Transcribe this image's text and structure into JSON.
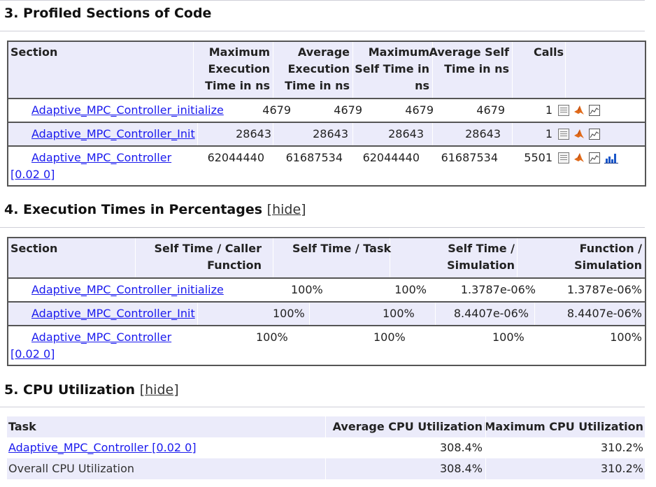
{
  "sections": {
    "profiled": {
      "title": "3. Profiled Sections of Code",
      "headers": {
        "section": "Section",
        "max_exec_l1": "Maximum",
        "max_exec_l2": "Execution",
        "max_exec_l3": "Time in ns",
        "avg_exec_l1": "Average",
        "avg_exec_l2": "Execution",
        "avg_exec_l3": "Time in ns",
        "max_self_l1": "Maximum",
        "max_self_l2": "Self Time in",
        "max_self_l3": "ns",
        "avg_self_l1": "Average Self",
        "avg_self_l2": "Time in ns",
        "calls": "Calls"
      },
      "rows": [
        {
          "name": "Adaptive_MPC_Controller_initialize",
          "max_exec": "4679",
          "avg_exec": "4679",
          "max_self": "4679",
          "avg_self": "4679",
          "calls": "1"
        },
        {
          "name": "Adaptive_MPC_Controller_Init",
          "max_exec": "28643",
          "avg_exec": "28643",
          "max_self": "28643",
          "avg_self": "28643",
          "calls": "1"
        },
        {
          "name": "Adaptive_MPC_Controller",
          "rate": "[0.02 0]",
          "max_exec": "62044440",
          "avg_exec": "61687534",
          "max_self": "62044440",
          "avg_self": "61687534",
          "calls": "5501"
        }
      ]
    },
    "percent": {
      "title": "4. Execution Times in Percentages",
      "hide_open": "[",
      "hide_label": "hide",
      "hide_close": "]",
      "headers": {
        "section": "Section",
        "self_caller_l1": "Self Time / Caller",
        "self_caller_l2": "Function",
        "self_task": "Self Time / Task",
        "self_sim_l1": "Self Time /",
        "self_sim_l2": "Simulation",
        "func_sim_l1": "Function /",
        "func_sim_l2": "Simulation"
      },
      "rows": [
        {
          "name": "Adaptive_MPC_Controller_initialize",
          "self_caller": "100%",
          "self_task": "100%",
          "self_sim": "1.3787e-06%",
          "func_sim": "1.3787e-06%"
        },
        {
          "name": "Adaptive_MPC_Controller_Init",
          "self_caller": "100%",
          "self_task": "100%",
          "self_sim": "8.4407e-06%",
          "func_sim": "8.4407e-06%"
        },
        {
          "name": "Adaptive_MPC_Controller",
          "rate": "[0.02 0]",
          "self_caller": "100%",
          "self_task": "100%",
          "self_sim": "100%",
          "func_sim": "100%"
        }
      ]
    },
    "cpu": {
      "title": "5. CPU Utilization",
      "hide_open": "[",
      "hide_label": "hide",
      "hide_close": "]",
      "headers": {
        "task": "Task",
        "avg": "Average CPU Utilization",
        "max": "Maximum CPU Utilization"
      },
      "rows": [
        {
          "task": "Adaptive_MPC_Controller [0.02 0]",
          "avg": "308.4%",
          "max": "310.2%"
        },
        {
          "task": "Overall CPU Utilization",
          "avg": "308.4%",
          "max": "310.2%"
        }
      ]
    }
  },
  "icons": [
    "report-icon",
    "matlab-icon",
    "plot-icon",
    "bar-chart-icon"
  ]
}
